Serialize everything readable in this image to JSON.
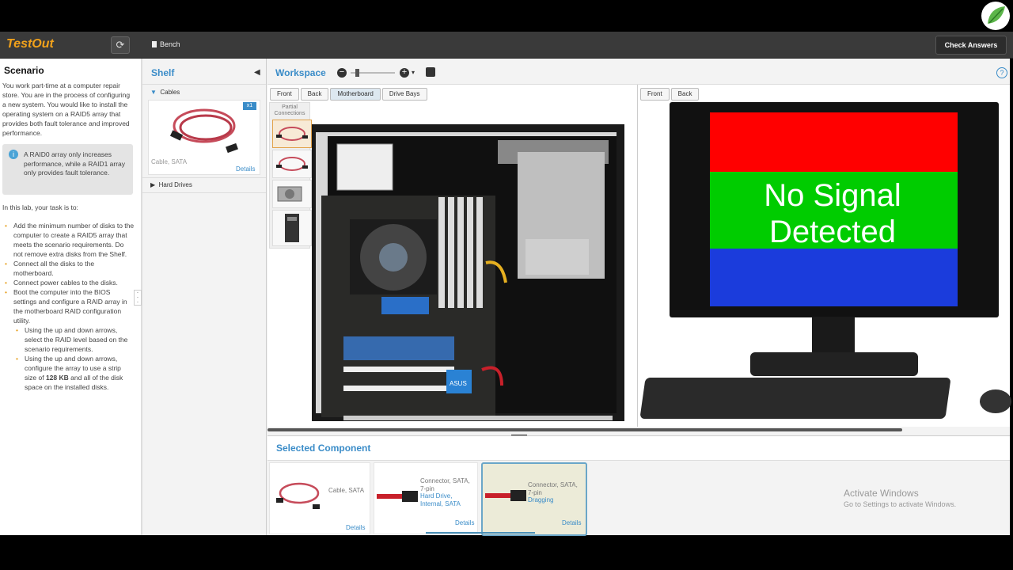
{
  "topbar": {
    "brand": "TestOut",
    "bench_label": "Bench",
    "check_answers_label": "Check Answers"
  },
  "scenario": {
    "title": "Scenario",
    "intro": "You work part-time at a computer repair store. You are in the process of configuring a new system. You would like to install the operating system on a RAID5 array that provides both fault tolerance and improved performance.",
    "note": "A RAID0 array only increases performance, while a RAID1 array only provides fault tolerance.",
    "task_intro": "In this lab, your task is to:",
    "tasks": [
      "Add the minimum number of disks to the computer to create a RAID5 array that meets the scenario requirements. Do not remove extra disks from the Shelf.",
      "Connect all the disks to the motherboard.",
      "Connect power cables to the disks.",
      "Boot the computer into the BIOS settings and configure a RAID array in the motherboard RAID configuration utility."
    ],
    "subtasks": {
      "first": "Using the up and down arrows, select the RAID level based on the scenario requirements.",
      "second_pre": "Using the up and down arrows, configure the array to use a strip size of ",
      "second_bold": "128 KB",
      "second_post": " and all of the disk space on the installed disks."
    }
  },
  "shelf": {
    "title": "Shelf",
    "sections": [
      {
        "label": "Cables",
        "expanded": true
      },
      {
        "label": "Hard Drives",
        "expanded": false
      }
    ],
    "item": {
      "label": "Cable, SATA",
      "count": "x1",
      "details": "Details"
    }
  },
  "workspace": {
    "title": "Workspace",
    "left_tabs": [
      "Front",
      "Back",
      "Motherboard",
      "Drive Bays"
    ],
    "active_left_tab": "Motherboard",
    "right_tabs": [
      "Front",
      "Back"
    ],
    "partial_label": "Partial Connections",
    "monitor_text_line1": "No Signal",
    "monitor_text_line2": "Detected",
    "motherboard_brand": "ASUS",
    "accent": "#3a8cc8"
  },
  "selected_component": {
    "title": "Selected Component",
    "cards": [
      {
        "label": "Cable, SATA",
        "details": "Details"
      },
      {
        "label": "Connector, SATA, 7-pin",
        "sublabel": "Hard Drive, Internal, SATA",
        "details": "Details"
      },
      {
        "label": "Connector, SATA, 7-pin",
        "sublabel": "Dragging",
        "details": "Details"
      }
    ]
  },
  "watermark": {
    "line1": "Activate Windows",
    "line2": "Go to Settings to activate Windows."
  }
}
